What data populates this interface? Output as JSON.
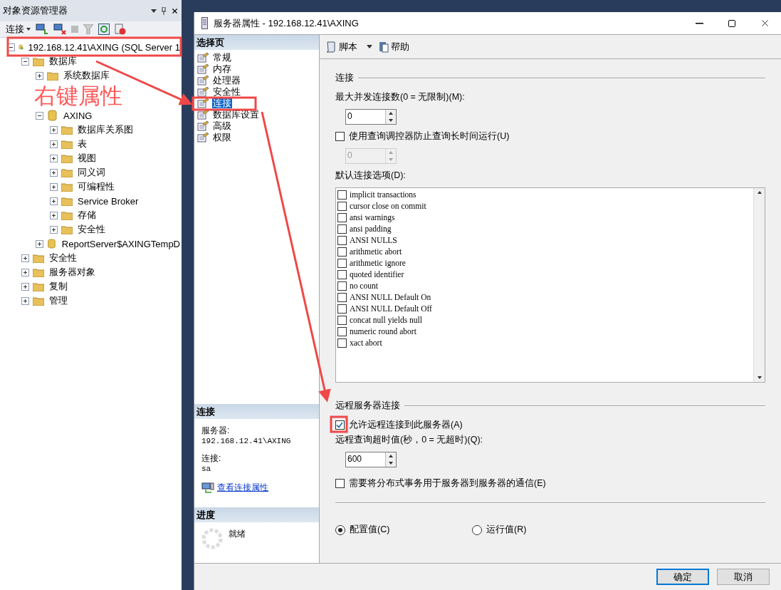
{
  "explorer": {
    "title": "对象资源管理器",
    "connect": "连接",
    "tree": [
      {
        "label": "192.168.12.41\\AXING (SQL Server 1",
        "kind": "server",
        "expanded": true,
        "children": [
          {
            "label": "数据库",
            "kind": "folder",
            "expanded": true,
            "children": [
              {
                "label": "系统数据库",
                "kind": "folder",
                "expanded": false
              },
              {
                "label": "AXING",
                "kind": "database",
                "expanded": true,
                "children": [
                  {
                    "label": "数据库关系图",
                    "kind": "folder",
                    "expanded": false
                  },
                  {
                    "label": "表",
                    "kind": "folder",
                    "expanded": false
                  },
                  {
                    "label": "视图",
                    "kind": "folder",
                    "expanded": false
                  },
                  {
                    "label": "同义词",
                    "kind": "folder",
                    "expanded": false
                  },
                  {
                    "label": "可编程性",
                    "kind": "folder",
                    "expanded": false
                  },
                  {
                    "label": "Service Broker",
                    "kind": "folder",
                    "expanded": false
                  },
                  {
                    "label": "存储",
                    "kind": "folder",
                    "expanded": false
                  },
                  {
                    "label": "安全性",
                    "kind": "folder",
                    "expanded": false
                  }
                ]
              },
              {
                "label": "ReportServer$AXINGTempD",
                "kind": "database",
                "expanded": false
              }
            ]
          },
          {
            "label": "安全性",
            "kind": "folder",
            "expanded": false
          },
          {
            "label": "服务器对象",
            "kind": "folder",
            "expanded": false
          },
          {
            "label": "复制",
            "kind": "folder",
            "expanded": false
          },
          {
            "label": "管理",
            "kind": "folder",
            "expanded": false
          }
        ]
      }
    ]
  },
  "annotation": {
    "text": "右键属性"
  },
  "dialog": {
    "title": "服务器属性 - 192.168.12.41\\AXING",
    "nav": {
      "header": "选择页",
      "items": [
        {
          "label": "常规",
          "selected": false
        },
        {
          "label": "内存",
          "selected": false
        },
        {
          "label": "处理器",
          "selected": false
        },
        {
          "label": "安全性",
          "selected": false
        },
        {
          "label": "连接",
          "selected": true
        },
        {
          "label": "数据库设置",
          "selected": false
        },
        {
          "label": "高级",
          "selected": false
        },
        {
          "label": "权限",
          "selected": false
        }
      ]
    },
    "connection": {
      "header": "连接",
      "server_label": "服务器:",
      "server": "192.168.12.41\\AXING",
      "login_label": "连接:",
      "login": "sa",
      "link": "查看连接属性"
    },
    "progress": {
      "header": "进度",
      "status": "就绪"
    },
    "toolbar": {
      "script": "脚本",
      "help": "帮助"
    },
    "content": {
      "section": "连接",
      "max_label": "最大并发连接数(0 = 无限制)(M):",
      "max_value": "0",
      "governor": {
        "label": "使用查询调控器防止查询长时间运行(U)",
        "checked": false
      },
      "governor_value": {
        "value": "0",
        "disabled": true
      },
      "options_label": "默认连接选项(D):",
      "options": [
        {
          "label": "implicit transactions",
          "checked": false
        },
        {
          "label": "cursor close on commit",
          "checked": false
        },
        {
          "label": "ansi warnings",
          "checked": false
        },
        {
          "label": "ansi padding",
          "checked": false
        },
        {
          "label": "ANSI NULLS",
          "checked": false
        },
        {
          "label": "arithmetic abort",
          "checked": false
        },
        {
          "label": "arithmetic ignore",
          "checked": false
        },
        {
          "label": "quoted identifier",
          "checked": false
        },
        {
          "label": "no count",
          "checked": false
        },
        {
          "label": "ANSI NULL Default On",
          "checked": false
        },
        {
          "label": "ANSI NULL Default Off",
          "checked": false
        },
        {
          "label": "concat null yields null",
          "checked": false
        },
        {
          "label": "numeric round abort",
          "checked": false
        },
        {
          "label": "xact abort",
          "checked": false
        }
      ],
      "remote_section": "远程服务器连接",
      "allow_remote": {
        "label": "允许远程连接到此服务器(A)",
        "checked": true
      },
      "timeout_label": "远程查询超时值(秒，0 = 无超时)(Q):",
      "timeout_value": "600",
      "distributed": {
        "label": "需要将分布式事务用于服务器到服务器的通信(E)",
        "checked": false
      },
      "radios": [
        {
          "label": "配置值(C)",
          "selected": true
        },
        {
          "label": "运行值(R)",
          "selected": false
        }
      ]
    },
    "buttons": [
      {
        "label": "确定",
        "default": true
      },
      {
        "label": "取消",
        "default": false
      }
    ]
  }
}
